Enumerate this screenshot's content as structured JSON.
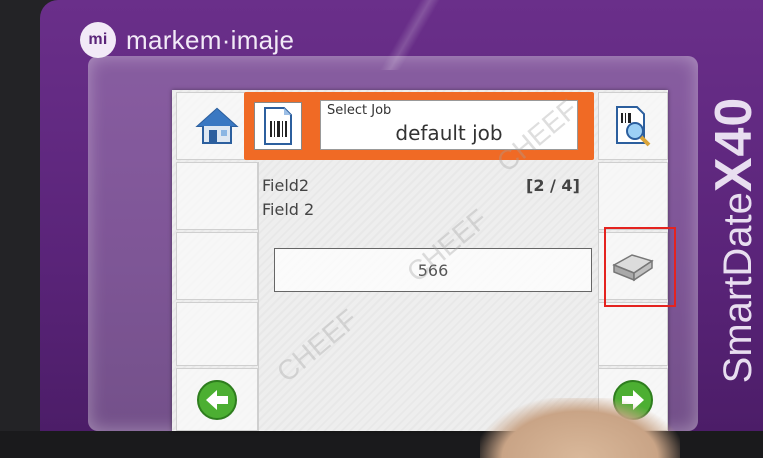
{
  "brand": {
    "logo_text": "mi",
    "name": "markem·imaje"
  },
  "model": {
    "name": "SmartDate",
    "number": "X40"
  },
  "job": {
    "label": "Select Job",
    "value": "default job"
  },
  "field": {
    "name": "Field2",
    "description": "Field 2",
    "counter": "[2 / 4]",
    "value": "566"
  },
  "icons": {
    "home": "home-icon",
    "job": "barcode-document-icon",
    "preview": "document-magnifier-icon",
    "keyboard": "keyboard-key-icon",
    "back": "arrow-left-icon",
    "next": "arrow-right-icon"
  },
  "watermark": "CHEEF",
  "colors": {
    "bezel": "#5a2479",
    "header": "#f06a25",
    "highlight": "#e4231f",
    "nav_arrow": "#4caf32"
  }
}
